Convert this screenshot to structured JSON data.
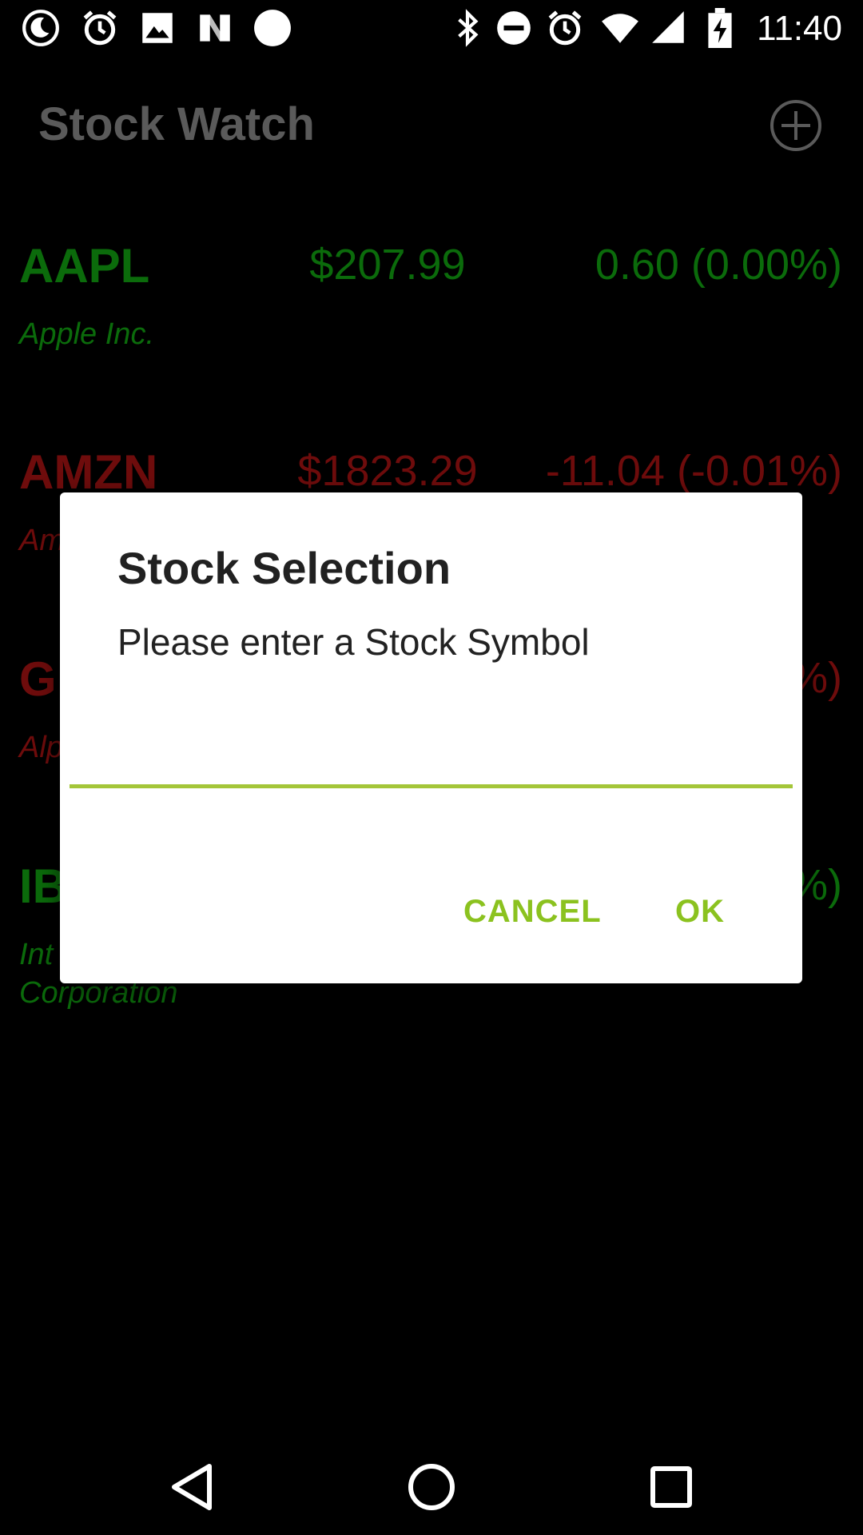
{
  "status_bar": {
    "time": "11:40",
    "left_icons": [
      "moon-icon",
      "alarm-icon",
      "image-icon",
      "n-icon",
      "circle-icon"
    ],
    "right_icons": [
      "bluetooth-icon",
      "do-not-disturb-icon",
      "alarm-icon",
      "wifi-icon",
      "signal-icon",
      "battery-charging-icon"
    ]
  },
  "app_bar": {
    "title": "Stock Watch",
    "add_icon": "add-circle-icon"
  },
  "stocks": [
    {
      "symbol": "AAPL",
      "price": "$207.99",
      "change": "0.60 (0.00%)",
      "name": "Apple Inc.",
      "trend": "up"
    },
    {
      "symbol": "AMZN",
      "price": "$1823.29",
      "change": "-11.04 (-0.01%)",
      "name": "Am",
      "trend": "down"
    },
    {
      "symbol": "G",
      "price": "",
      "change": "%)",
      "name": "Alp",
      "trend": "down"
    },
    {
      "symbol": "IB",
      "price": "",
      "change": "%)",
      "name": "Int\nCorporation",
      "trend": "up"
    }
  ],
  "dialog": {
    "title": "Stock Selection",
    "message": "Please enter a Stock Symbol",
    "input_value": "",
    "cancel_label": "CANCEL",
    "ok_label": "OK"
  },
  "colors": {
    "accent": "#8bc21f",
    "up": "#0b6b0b",
    "down": "#6e0c0c",
    "background": "#000000",
    "dialog_background": "#ffffff"
  },
  "nav_bar": {
    "icons": [
      "back-icon",
      "home-icon",
      "recents-icon"
    ]
  }
}
